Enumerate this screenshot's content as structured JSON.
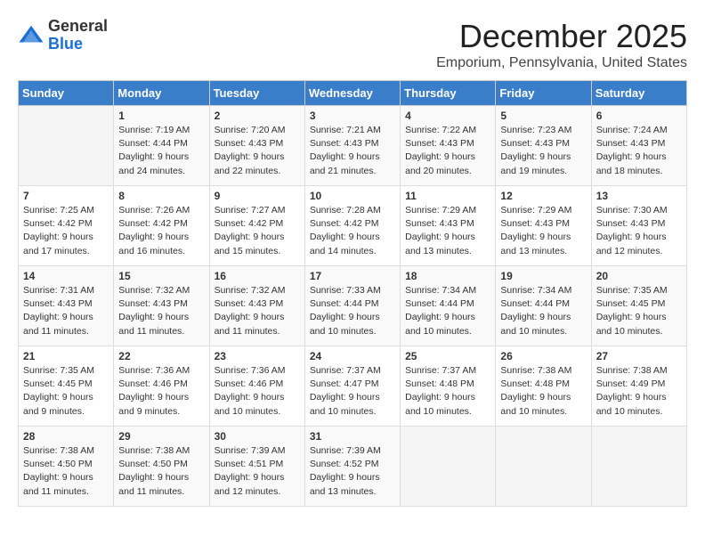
{
  "logo": {
    "general": "General",
    "blue": "Blue"
  },
  "title": "December 2025",
  "location": "Emporium, Pennsylvania, United States",
  "days_of_week": [
    "Sunday",
    "Monday",
    "Tuesday",
    "Wednesday",
    "Thursday",
    "Friday",
    "Saturday"
  ],
  "weeks": [
    [
      {
        "day": "",
        "info": ""
      },
      {
        "day": "1",
        "info": "Sunrise: 7:19 AM\nSunset: 4:44 PM\nDaylight: 9 hours\nand 24 minutes."
      },
      {
        "day": "2",
        "info": "Sunrise: 7:20 AM\nSunset: 4:43 PM\nDaylight: 9 hours\nand 22 minutes."
      },
      {
        "day": "3",
        "info": "Sunrise: 7:21 AM\nSunset: 4:43 PM\nDaylight: 9 hours\nand 21 minutes."
      },
      {
        "day": "4",
        "info": "Sunrise: 7:22 AM\nSunset: 4:43 PM\nDaylight: 9 hours\nand 20 minutes."
      },
      {
        "day": "5",
        "info": "Sunrise: 7:23 AM\nSunset: 4:43 PM\nDaylight: 9 hours\nand 19 minutes."
      },
      {
        "day": "6",
        "info": "Sunrise: 7:24 AM\nSunset: 4:43 PM\nDaylight: 9 hours\nand 18 minutes."
      }
    ],
    [
      {
        "day": "7",
        "info": "Sunrise: 7:25 AM\nSunset: 4:42 PM\nDaylight: 9 hours\nand 17 minutes."
      },
      {
        "day": "8",
        "info": "Sunrise: 7:26 AM\nSunset: 4:42 PM\nDaylight: 9 hours\nand 16 minutes."
      },
      {
        "day": "9",
        "info": "Sunrise: 7:27 AM\nSunset: 4:42 PM\nDaylight: 9 hours\nand 15 minutes."
      },
      {
        "day": "10",
        "info": "Sunrise: 7:28 AM\nSunset: 4:42 PM\nDaylight: 9 hours\nand 14 minutes."
      },
      {
        "day": "11",
        "info": "Sunrise: 7:29 AM\nSunset: 4:43 PM\nDaylight: 9 hours\nand 13 minutes."
      },
      {
        "day": "12",
        "info": "Sunrise: 7:29 AM\nSunset: 4:43 PM\nDaylight: 9 hours\nand 13 minutes."
      },
      {
        "day": "13",
        "info": "Sunrise: 7:30 AM\nSunset: 4:43 PM\nDaylight: 9 hours\nand 12 minutes."
      }
    ],
    [
      {
        "day": "14",
        "info": "Sunrise: 7:31 AM\nSunset: 4:43 PM\nDaylight: 9 hours\nand 11 minutes."
      },
      {
        "day": "15",
        "info": "Sunrise: 7:32 AM\nSunset: 4:43 PM\nDaylight: 9 hours\nand 11 minutes."
      },
      {
        "day": "16",
        "info": "Sunrise: 7:32 AM\nSunset: 4:43 PM\nDaylight: 9 hours\nand 11 minutes."
      },
      {
        "day": "17",
        "info": "Sunrise: 7:33 AM\nSunset: 4:44 PM\nDaylight: 9 hours\nand 10 minutes."
      },
      {
        "day": "18",
        "info": "Sunrise: 7:34 AM\nSunset: 4:44 PM\nDaylight: 9 hours\nand 10 minutes."
      },
      {
        "day": "19",
        "info": "Sunrise: 7:34 AM\nSunset: 4:44 PM\nDaylight: 9 hours\nand 10 minutes."
      },
      {
        "day": "20",
        "info": "Sunrise: 7:35 AM\nSunset: 4:45 PM\nDaylight: 9 hours\nand 10 minutes."
      }
    ],
    [
      {
        "day": "21",
        "info": "Sunrise: 7:35 AM\nSunset: 4:45 PM\nDaylight: 9 hours\nand 9 minutes."
      },
      {
        "day": "22",
        "info": "Sunrise: 7:36 AM\nSunset: 4:46 PM\nDaylight: 9 hours\nand 9 minutes."
      },
      {
        "day": "23",
        "info": "Sunrise: 7:36 AM\nSunset: 4:46 PM\nDaylight: 9 hours\nand 10 minutes."
      },
      {
        "day": "24",
        "info": "Sunrise: 7:37 AM\nSunset: 4:47 PM\nDaylight: 9 hours\nand 10 minutes."
      },
      {
        "day": "25",
        "info": "Sunrise: 7:37 AM\nSunset: 4:48 PM\nDaylight: 9 hours\nand 10 minutes."
      },
      {
        "day": "26",
        "info": "Sunrise: 7:38 AM\nSunset: 4:48 PM\nDaylight: 9 hours\nand 10 minutes."
      },
      {
        "day": "27",
        "info": "Sunrise: 7:38 AM\nSunset: 4:49 PM\nDaylight: 9 hours\nand 10 minutes."
      }
    ],
    [
      {
        "day": "28",
        "info": "Sunrise: 7:38 AM\nSunset: 4:50 PM\nDaylight: 9 hours\nand 11 minutes."
      },
      {
        "day": "29",
        "info": "Sunrise: 7:38 AM\nSunset: 4:50 PM\nDaylight: 9 hours\nand 11 minutes."
      },
      {
        "day": "30",
        "info": "Sunrise: 7:39 AM\nSunset: 4:51 PM\nDaylight: 9 hours\nand 12 minutes."
      },
      {
        "day": "31",
        "info": "Sunrise: 7:39 AM\nSunset: 4:52 PM\nDaylight: 9 hours\nand 13 minutes."
      },
      {
        "day": "",
        "info": ""
      },
      {
        "day": "",
        "info": ""
      },
      {
        "day": "",
        "info": ""
      }
    ]
  ]
}
